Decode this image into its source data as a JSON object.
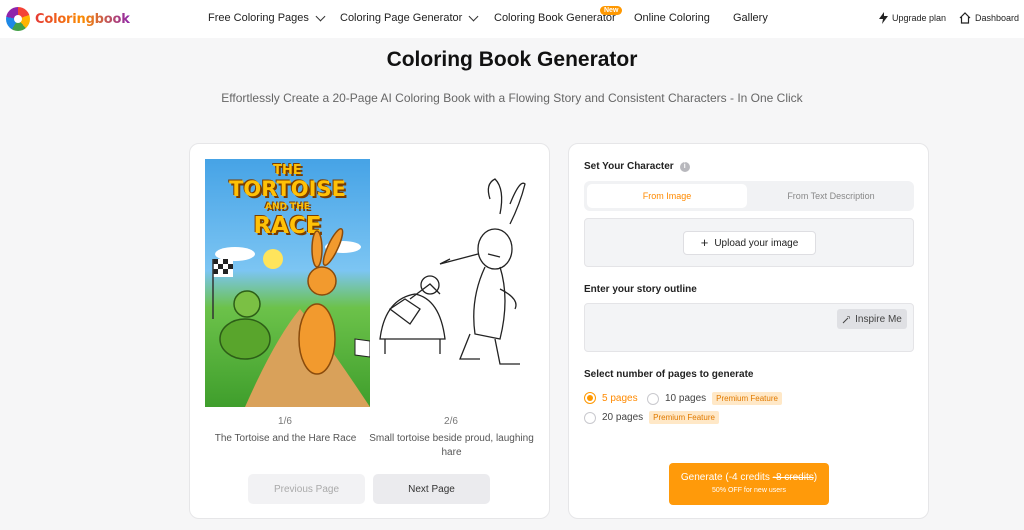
{
  "brand": {
    "name": "Coloringbook"
  },
  "nav": {
    "items": [
      {
        "label": "Free Coloring Pages",
        "dropdown": true
      },
      {
        "label": "Coloring Page Generator",
        "dropdown": true
      },
      {
        "label": "Coloring Book Generator",
        "dropdown": false,
        "badge": "New"
      },
      {
        "label": "Online Coloring",
        "dropdown": false
      },
      {
        "label": "Gallery",
        "dropdown": false
      }
    ],
    "upgrade": "Upgrade plan",
    "dashboard": "Dashboard"
  },
  "hero": {
    "title": "Coloring Book Generator",
    "subtitle": "Effortlessly Create a 20-Page AI Coloring Book with a Flowing Story and Consistent Characters - In One Click"
  },
  "preview": {
    "cover_art_title": {
      "line1": "THE",
      "line2": "TORTOISE",
      "line3": "AND THE",
      "line4": "RACE"
    },
    "pages": [
      {
        "number": "1/6",
        "caption": "The Tortoise and the Hare Race"
      },
      {
        "number": "2/6",
        "caption": "Small tortoise beside proud, laughing hare"
      }
    ],
    "prev_label": "Previous Page",
    "next_label": "Next Page"
  },
  "form": {
    "character_label": "Set Your Character",
    "info_icon": "i",
    "tabs": [
      {
        "label": "From Image",
        "active": true
      },
      {
        "label": "From Text Description",
        "active": false
      }
    ],
    "upload_label": "Upload your image",
    "story_label": "Enter your story outline",
    "inspire_label": "Inspire Me",
    "pages_label": "Select number of pages to generate",
    "page_options": [
      {
        "label": "5 pages",
        "selected": true,
        "premium": ""
      },
      {
        "label": "10 pages",
        "selected": false,
        "premium": "Premium Feature"
      },
      {
        "label": "20 pages",
        "selected": false,
        "premium": "Premium Feature"
      }
    ],
    "generate": {
      "prefix": "Generate (-4 credits ",
      "strike": "-8 credits",
      "suffix": ")",
      "sub": "50% OFF for new users"
    }
  },
  "colors": {
    "accent": "#ff9800",
    "premium_bg": "#ffe8c7"
  }
}
